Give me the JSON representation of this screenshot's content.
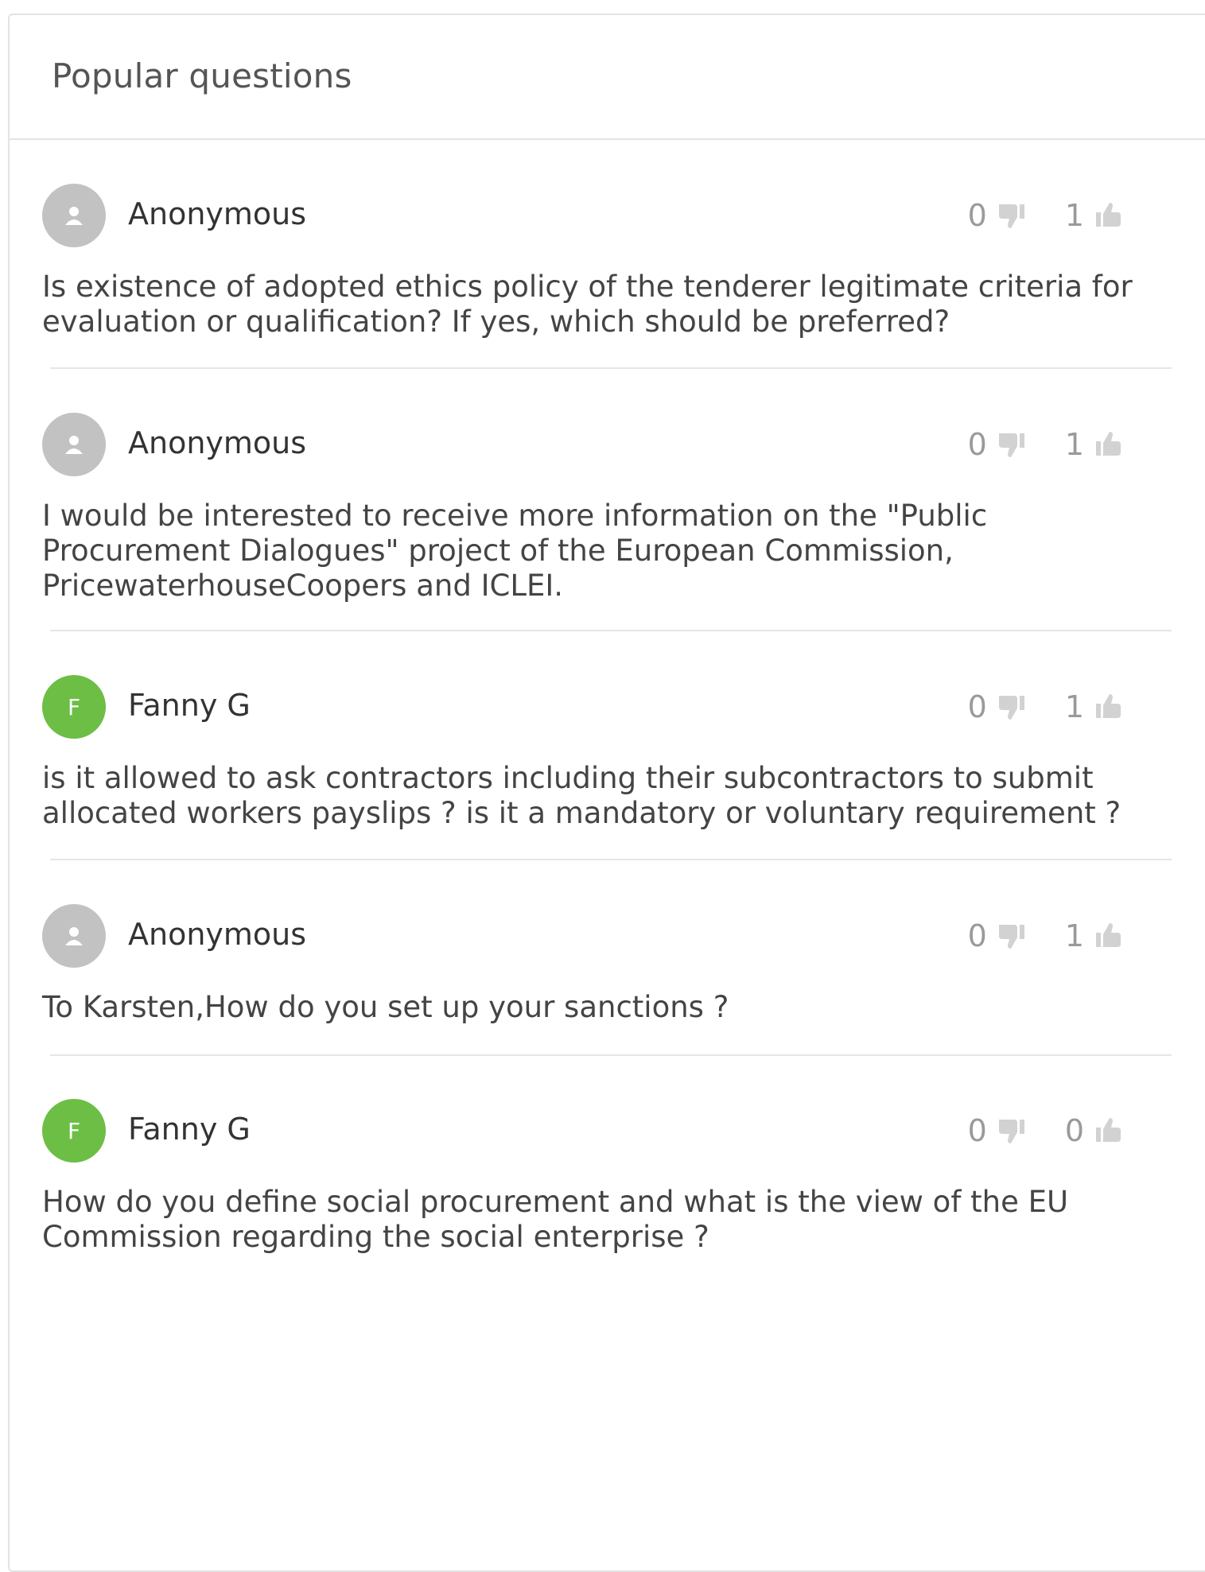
{
  "panel": {
    "title": "Popular questions"
  },
  "questions": [
    {
      "author": "Anonymous",
      "avatar": "user-icon",
      "downvotes": "0",
      "upvotes": "1",
      "text": "Is existence of adopted ethics policy of the tenderer legitimate criteria for evaluation or qualification? If yes, which should be preferred?"
    },
    {
      "author": "Anonymous",
      "avatar": "user-icon",
      "downvotes": "0",
      "upvotes": "1",
      "text": "I would be interested to receive more information on the \"Public Procurement Dialogues\" project of the European Commission, PricewaterhouseCoopers and ICLEI."
    },
    {
      "author": "Fanny G",
      "avatar": "F",
      "avatar_color": "#6cbe45",
      "downvotes": "0",
      "upvotes": "1",
      "text": "is it allowed to ask contractors including their subcontractors to submit allocated workers payslips ? is it a mandatory or voluntary requirement ?"
    },
    {
      "author": "Anonymous",
      "avatar": "user-icon",
      "downvotes": "0",
      "upvotes": "1",
      "text": "To Karsten,How do you set up your sanctions ?"
    },
    {
      "author": "Fanny G",
      "avatar": "F",
      "avatar_color": "#6cbe45",
      "downvotes": "0",
      "upvotes": "0",
      "text": "How do you define social procurement and what is the view of the EU Commission regarding the social enterprise ?"
    }
  ],
  "icons": {
    "downvote": "thumbs-down-icon",
    "upvote": "thumbs-up-icon",
    "anonymous": "user-icon"
  },
  "colors": {
    "anonymous_avatar": "#c2c2c2",
    "user_avatar": "#6cbe45",
    "vote_text": "#9a9a9a"
  }
}
